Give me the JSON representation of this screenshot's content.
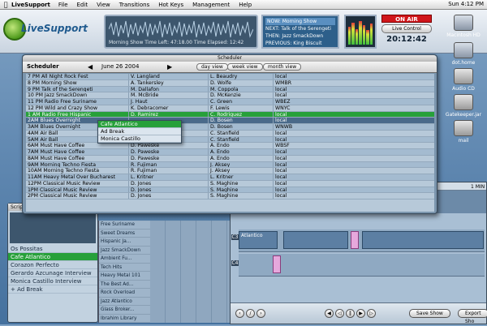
{
  "menubar": {
    "app": "LiveSupport",
    "items": [
      "File",
      "Edit",
      "View",
      "Transitions",
      "Hot Keys",
      "Management",
      "Help"
    ],
    "clock": "Sun 4:12 PM"
  },
  "header": {
    "logo_text": "LiveSupport",
    "now_status": "Morning Show  Time Left: 47:18.00  Time Elapsed: 12:42",
    "queue": {
      "now": "NOW: Morning Show",
      "next": "NEXT: Talk of the Serengeti",
      "then": "THEN: Jazz SmackDown",
      "previous": "PREVIOUS: King Biscuit"
    },
    "on_air": "ON AIR",
    "live_control": "Live Control",
    "clock": "20:12:42"
  },
  "desktop_icons": [
    "Macintosh HD",
    "dot.home",
    "Audio CD",
    "Gatekeeper.jar",
    "mail"
  ],
  "scheduler": {
    "window_title": "Scheduler",
    "title": "Scheduler",
    "date": "June 26 2004",
    "views": [
      "day view",
      "week view",
      "month view"
    ],
    "rows": [
      [
        "7 PM  All Night Rock Fest",
        "V. Langland",
        "L. Beaudry",
        "local"
      ],
      [
        "8 PM  Morning Show",
        "A. Tankersley",
        "D. Wolfe",
        "WMBR"
      ],
      [
        "9 PM  Talk of the Serengeti",
        "M. Dallafon",
        "M. Coppola",
        "local"
      ],
      [
        "10 PM  Jazz SmackDown",
        "M. McBride",
        "D. McKenzie",
        "local"
      ],
      [
        "11 PM  Radio Free Suriname",
        "J. Haut",
        "C. Green",
        "WBEZ"
      ],
      [
        "12 PM  Wild and Crazy Show",
        "K. Debracomer",
        "F. Lewis",
        "WNYC"
      ],
      [
        "1 AM  Radio Free Hispanic",
        "D. Ramirez",
        "C. Rodriguez",
        "local"
      ],
      [
        "2AM  Blues Overnight",
        "",
        "D. Bosen",
        "local"
      ],
      [
        "3AM  Blues Overnight",
        "",
        "D. Bosen",
        "WNWB"
      ],
      [
        "4AM  Air Ball",
        "",
        "C. Stanfield",
        "local"
      ],
      [
        "5AM  Air Ball",
        "A. Bell",
        "C. Stanfield",
        "local"
      ],
      [
        "6AM  Must Have Coffee",
        "D. Paweske",
        "A. Endo",
        "WBSF"
      ],
      [
        "7AM  Must Have Coffee",
        "D. Paweske",
        "A. Endo",
        "local"
      ],
      [
        "8AM  Must Have Coffee",
        "D. Paweske",
        "A. Endo",
        "local"
      ],
      [
        "9AM  Morning Techno Fiesta",
        "R. Fujiman",
        "J. Aksey",
        "local"
      ],
      [
        "10AM  Morning Techno Fiesta",
        "R. Fujiman",
        "J. Aksey",
        "local"
      ],
      [
        "11AM  Heavy Metal Over Bucharest",
        "L. Kritner",
        "L. Kritner",
        "local"
      ],
      [
        "12PM  Classical Music Review",
        "D. Jones",
        "S. Maghine",
        "local"
      ],
      [
        "1PM  Classical Music Review",
        "D. Jones",
        "S. Maghine",
        "local"
      ],
      [
        "2PM  Classical Music Review",
        "D. Jones",
        "S. Maghine",
        "local"
      ]
    ],
    "popup": [
      "Cafe Atlantico",
      "Ad Break",
      "Monica Castillo"
    ]
  },
  "script_window": {
    "title": "Script",
    "items": [
      "Os Possitas",
      "Cafe Atlantico",
      "Corazon Perfecto",
      "Gerardo Azcunage Interview",
      "Monica Castillo Interview",
      "+ Ad Break"
    ]
  },
  "mid_list": [
    "Free Suriname",
    "Sweet Dreams",
    "Hispanic Ja...",
    "Jazz SmackDown",
    "Ambient Fu...",
    "Tech Hits",
    "Heavy Metal 101",
    "The Best Ad...",
    "Rock Overload",
    "Jazz Atlantico",
    "Glass Broker...",
    "Ibrahim Library"
  ],
  "editor": {
    "ruler_label": "1 MIN",
    "clip_label": "Atlantico",
    "track_labels": [
      "C3",
      "C4"
    ],
    "save_show": "Save Show",
    "export_show": "Export Sho"
  }
}
